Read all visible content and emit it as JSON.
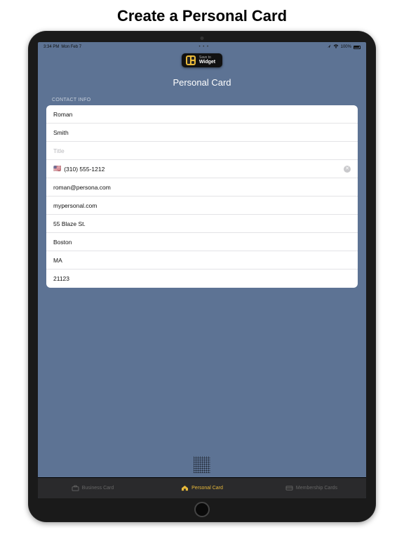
{
  "marketing": {
    "headline": "Create a Personal Card"
  },
  "status": {
    "time": "3:34 PM",
    "date": "Mon Feb 7",
    "ellipsis": "• • •",
    "battery_pct": "100%"
  },
  "widget_button": {
    "small": "Save to",
    "big": "Widget"
  },
  "page": {
    "title": "Personal Card"
  },
  "section_label": "CONTACT INFO",
  "form": {
    "first_name": "Roman",
    "last_name": "Smith",
    "title_placeholder": "Title",
    "flag": "🇺🇸",
    "phone": "(310) 555-1212",
    "email": "roman@persona.com",
    "website": "mypersonal.com",
    "street": "55 Blaze St.",
    "city": "Boston",
    "state": "MA",
    "zip": "21123"
  },
  "tabs": {
    "business": "Business Card",
    "personal": "Personal Card",
    "membership": "Membership Cards"
  }
}
